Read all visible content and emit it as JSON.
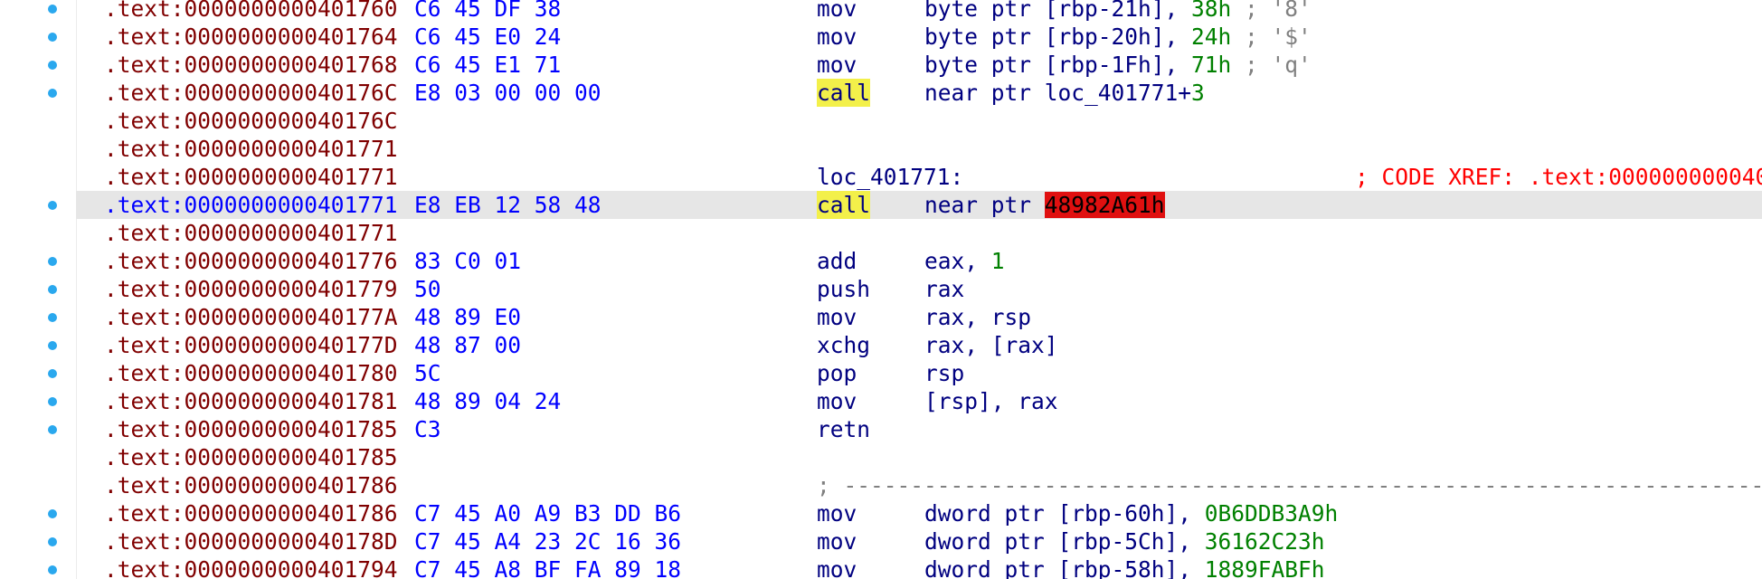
{
  "colors": {
    "address": "#800000",
    "address_selected": "#0000ff",
    "bytes": "#0000ff",
    "code": "#000080",
    "number": "#008000",
    "comment": "#808080",
    "xref": "#ff0000",
    "highlight": "#f3f04a",
    "error_bg": "#e01010",
    "selection": "#e6e6e6",
    "breakpoint_dot": "#2aa8ee"
  },
  "lines": [
    {
      "addr": ".text:0000000000401760",
      "bytes": "C6 45 DF 38",
      "mnem": "mov",
      "ops_pre": "byte ptr [rbp-21h], ",
      "ops_num": "38h",
      "ops_cmt": " ; '8'"
    },
    {
      "addr": ".text:0000000000401764",
      "bytes": "C6 45 E0 24",
      "mnem": "mov",
      "ops_pre": "byte ptr [rbp-20h], ",
      "ops_num": "24h",
      "ops_cmt": " ; '$'"
    },
    {
      "addr": ".text:0000000000401768",
      "bytes": "C6 45 E1 71",
      "mnem": "mov",
      "ops_pre": "byte ptr [rbp-1Fh], ",
      "ops_num": "71h",
      "ops_cmt": " ; 'q'"
    },
    {
      "addr": ".text:000000000040176C",
      "bytes": "E8 03 00 00 00",
      "mnem": "call",
      "ops_pre": "near ptr loc_401771+",
      "ops_num": "3"
    },
    {
      "addr": ".text:000000000040176C"
    },
    {
      "addr": ".text:0000000000401771"
    },
    {
      "addr": ".text:0000000000401771",
      "label": "loc_401771:",
      "xref": "; CODE XREF: .text:000000000040"
    },
    {
      "addr": ".text:0000000000401771",
      "bytes": "E8 EB 12 58 48",
      "mnem": "call",
      "ops_pre": "near ptr ",
      "ops_bad": "48982A61h"
    },
    {
      "addr": ".text:0000000000401771"
    },
    {
      "addr": ".text:0000000000401776",
      "bytes": "83 C0 01",
      "mnem": "add",
      "ops_pre": "eax, ",
      "ops_num": "1"
    },
    {
      "addr": ".text:0000000000401779",
      "bytes": "50",
      "mnem": "push",
      "ops_pre": "rax"
    },
    {
      "addr": ".text:000000000040177A",
      "bytes": "48 89 E0",
      "mnem": "mov",
      "ops_pre": "rax, rsp"
    },
    {
      "addr": ".text:000000000040177D",
      "bytes": "48 87 00",
      "mnem": "xchg",
      "ops_pre": "rax, [rax]"
    },
    {
      "addr": ".text:0000000000401780",
      "bytes": "5C",
      "mnem": "pop",
      "ops_pre": "rsp"
    },
    {
      "addr": ".text:0000000000401781",
      "bytes": "48 89 04 24",
      "mnem": "mov",
      "ops_pre": "[rsp], rax"
    },
    {
      "addr": ".text:0000000000401785",
      "bytes": "C3",
      "mnem": "retn"
    },
    {
      "addr": ".text:0000000000401785"
    },
    {
      "addr": ".text:0000000000401786",
      "separator": "; ---------------------------------------------------------------------------"
    },
    {
      "addr": ".text:0000000000401786",
      "bytes": "C7 45 A0 A9 B3 DD B6",
      "mnem": "mov",
      "ops_pre": "dword ptr [rbp-60h], ",
      "ops_num": "0B6DDB3A9h"
    },
    {
      "addr": ".text:000000000040178D",
      "bytes": "C7 45 A4 23 2C 16 36",
      "mnem": "mov",
      "ops_pre": "dword ptr [rbp-5Ch], ",
      "ops_num": "36162C23h"
    },
    {
      "addr": ".text:0000000000401794",
      "bytes": "C7 45 A8 BF FA 89 18",
      "mnem": "mov",
      "ops_pre": "dword ptr [rbp-58h], ",
      "ops_num": "1889FABFh"
    }
  ]
}
